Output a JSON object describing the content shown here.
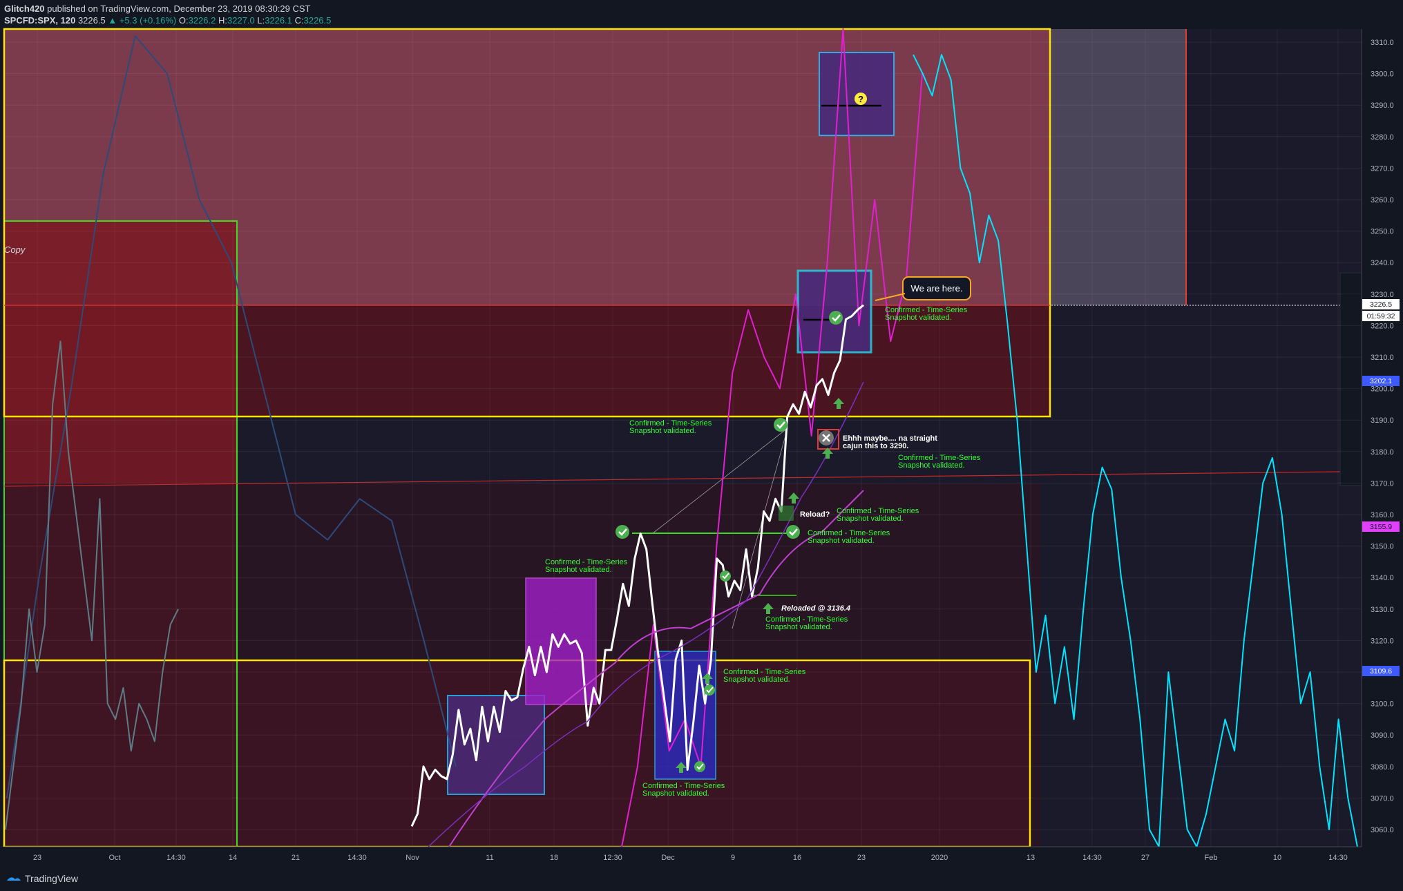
{
  "header": {
    "author": "Glitch420",
    "published": "published on TradingView.com, December 23, 2019 08:30:29 CST",
    "symbol": "SPCFD:SPX, 120",
    "last": "3226.5",
    "change": "+5.3 (+0.16%)",
    "o_label": "O:",
    "o": "3226.2",
    "h_label": "H:",
    "h": "3227.0",
    "l_label": "L:",
    "l": "3226.1",
    "c_label": "C:",
    "c": "3226.5"
  },
  "footer": {
    "brand": "TradingView"
  },
  "colors": {
    "background": "#131722",
    "price_line": "#ffffff",
    "projection": "#00e5ff",
    "history": "#5d7d86",
    "momentum": "#e01fd1",
    "zone_yellow": "#ffe500",
    "zone_green": "#3ddc1f",
    "confirm_text": "#33ff33",
    "axis_text": "#b2b5be"
  },
  "chart_data": {
    "type": "line",
    "symbol": "SPCFD:SPX",
    "interval": "120",
    "ylim": [
      3056,
      3314
    ],
    "y_ticks": [
      3060,
      3070,
      3080,
      3090,
      3100,
      3110,
      3120,
      3130,
      3140,
      3150,
      3160,
      3170,
      3180,
      3190,
      3200,
      3210,
      3220,
      3230,
      3240,
      3250,
      3260,
      3270,
      3280,
      3290,
      3300,
      3310
    ],
    "x_ticks": [
      "23",
      "Oct",
      "14:30",
      "14",
      "21",
      "14:30",
      "Nov",
      "11",
      "18",
      "12:30",
      "Dec",
      "9",
      "16",
      "23",
      "2020",
      "13",
      "14:30",
      "27",
      "Feb",
      "10",
      "14:30"
    ],
    "price_labels": [
      {
        "text": "3226.5",
        "kind": "last"
      },
      {
        "text": "01:59:32",
        "kind": "timer"
      },
      {
        "text": "3202.1",
        "kind": "blue"
      },
      {
        "text": "3155.9",
        "kind": "pink"
      },
      {
        "text": "3109.6",
        "kind": "blue"
      }
    ],
    "series": [
      {
        "role": "price",
        "y": [
          3061,
          3065,
          3080,
          3076,
          3079,
          3077,
          3076,
          3084,
          3098,
          3087,
          3092,
          3082,
          3099,
          3088,
          3099,
          3091,
          3104,
          3101,
          3102,
          3111,
          3118,
          3109,
          3118,
          3110,
          3122,
          3118,
          3122,
          3119,
          3120,
          3116,
          3093,
          3105,
          3100,
          3117,
          3117,
          3127,
          3138,
          3131,
          3146,
          3154,
          3149,
          3132,
          3116,
          3102,
          3088,
          3114,
          3120,
          3079,
          3094,
          3112,
          3100,
          3114,
          3146,
          3144,
          3134,
          3139,
          3136,
          3149,
          3134,
          3143,
          3161,
          3158,
          3165,
          3161,
          3191,
          3195,
          3192,
          3199,
          3194,
          3201,
          3203,
          3198,
          3205,
          3209,
          3222,
          3223,
          3225,
          3226.5
        ]
      },
      {
        "role": "projection",
        "y": [
          3306,
          3300,
          3293,
          3306,
          3298,
          3270,
          3262,
          3240,
          3255,
          3247,
          3220,
          3190,
          3150,
          3110,
          3128,
          3100,
          3118,
          3095,
          3130,
          3160,
          3175,
          3168,
          3140,
          3120,
          3095,
          3060,
          3040,
          3110,
          3085,
          3060,
          3040,
          3065,
          3080,
          3095,
          3085,
          3120,
          3145,
          3170,
          3178,
          3160,
          3130,
          3100,
          3110,
          3080,
          3060,
          3095,
          3070,
          3050
        ]
      },
      {
        "role": "history",
        "y": [
          3060,
          3080,
          3100,
          3130,
          3110,
          3125,
          3195,
          3215,
          3180,
          3160,
          3140,
          3120,
          3165,
          3100,
          3095,
          3105,
          3085,
          3100,
          3095,
          3088,
          3110,
          3125,
          3130
        ]
      },
      {
        "role": "momentum",
        "y": [
          3030,
          3080,
          3125,
          3085,
          3095,
          3080,
          3150,
          3205,
          3225,
          3210,
          3200,
          3230,
          3185,
          3240,
          3330,
          3220,
          3260,
          3215,
          3235,
          3300
        ]
      },
      {
        "role": "macro",
        "y": [
          3070,
          3140,
          3200,
          3268,
          3312,
          3300,
          3260,
          3240,
          3200,
          3160,
          3152,
          3165,
          3158,
          3120,
          3080
        ]
      }
    ],
    "annotations": [
      {
        "text": "Copy",
        "kind": "label"
      },
      {
        "text": "We are here.",
        "kind": "callout"
      },
      {
        "text": "?",
        "kind": "question"
      },
      {
        "text": "Confirmed - Time-Series",
        "text2": "Snapshot validated.",
        "kind": "confirm",
        "price": 3226
      },
      {
        "text": "Confirmed - Time-Series",
        "text2": "Snapshot validated.",
        "kind": "confirm",
        "price": 3190
      },
      {
        "text": "Confirmed - Time-Series",
        "text2": "Snapshot validated.",
        "kind": "confirm",
        "price": 3178
      },
      {
        "text": "Confirmed - Time-Series",
        "text2": "Snapshot validated.",
        "kind": "confirm",
        "price": 3161
      },
      {
        "text": "Confirmed - Time-Series",
        "text2": "Snapshot validated.",
        "kind": "confirm",
        "price": 3154
      },
      {
        "text": "Confirmed - Time-Series",
        "text2": "Snapshot validated.",
        "kind": "confirm",
        "price": 3142
      },
      {
        "text": "Confirmed - Time-Series",
        "text2": "Snapshot validated.",
        "kind": "confirm",
        "price": 3128
      },
      {
        "text": "Confirmed - Time-Series",
        "text2": "Snapshot validated.",
        "kind": "confirm",
        "price": 3106
      },
      {
        "text": "Confirmed - Time-Series",
        "text2": "Snapshot validated.",
        "kind": "confirm",
        "price": 3071
      },
      {
        "text": "Ehhh maybe.... na straight",
        "text2": "cajun this to 3290.",
        "kind": "note"
      },
      {
        "text": "Reload?",
        "kind": "note"
      },
      {
        "text": "Reloaded @ 3136.4",
        "kind": "note"
      }
    ],
    "grid": true
  }
}
